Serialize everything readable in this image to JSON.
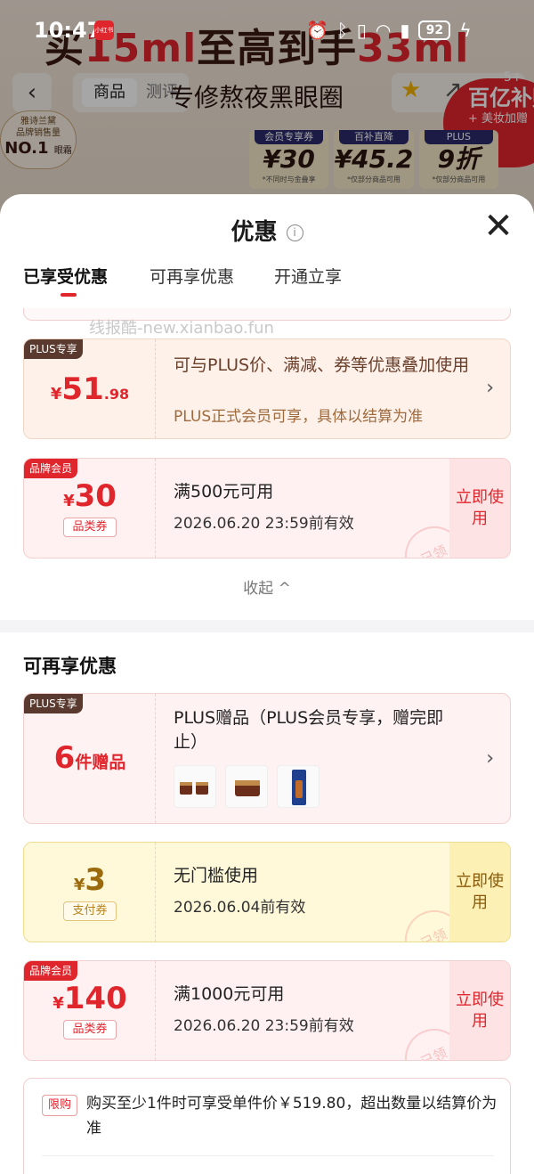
{
  "status_bar": {
    "time": "10:47",
    "app_badge": "小红书",
    "battery": "92"
  },
  "background": {
    "banner_prefix": "买",
    "banner_red1": "15ml",
    "banner_middle": "至高到手",
    "banner_red2": "33ml",
    "subtitle": "专修熬夜黑眼圈",
    "tab_product": "商品",
    "tab_review": "测评",
    "subsidy_badge": "5+",
    "subsidy_main": "百亿补贴",
    "subsidy_sub": "+ 美妆加赠",
    "no1_line1": "雅诗兰黛",
    "no1_line2": "品牌销售量",
    "no1_big": "NO.1",
    "no1_line3": "眼霜",
    "coupons": [
      {
        "tag": "会员专享券",
        "value": "¥30",
        "note": "*不同时与金叠享"
      },
      {
        "tag": "百补直降",
        "value": "¥45.2",
        "note": "*仅部分商品可用"
      },
      {
        "tag": "PLUS",
        "value": "9折",
        "note": "*仅部分商品可用"
      }
    ]
  },
  "sheet": {
    "title": "优惠",
    "close": "✕",
    "tabs": [
      "已享受优惠",
      "可再享优惠",
      "开通立享"
    ],
    "watermark": "线报酷-new.xianbao.fun",
    "plus_card": {
      "tag": "PLUS专享",
      "currency": "¥",
      "amount_int": "51",
      "amount_dec": ".98",
      "line1": "可与PLUS价、满减、券等优惠叠加使用",
      "line2": "PLUS正式会员可享，具体以结算为准"
    },
    "brand_card_1": {
      "tag": "品牌会员",
      "currency": "¥",
      "amount": "30",
      "type": "品类券",
      "line1": "满500元可用",
      "line2": "2026.06.20 23:59前有效",
      "button": "立即使用",
      "stamp": "已领"
    },
    "collapse": "收起 ^",
    "section_title": "可再享优惠",
    "gift_card": {
      "tag": "PLUS专享",
      "count": "6",
      "count_suffix": "件赠品",
      "line1": "PLUS赠品（PLUS会员专享，赠完即止）"
    },
    "pay_card": {
      "currency": "¥",
      "amount": "3",
      "type": "支付券",
      "line1": "无门槛使用",
      "line2": "2026.06.04前有效",
      "button": "立即使用",
      "stamp": "已领"
    },
    "brand_card_2": {
      "tag": "品牌会员",
      "currency": "¥",
      "amount": "140",
      "type": "品类券",
      "line1": "满1000元可用",
      "line2": "2026.06.20 23:59前有效",
      "button": "立即使用",
      "stamp": "已领"
    },
    "limit": {
      "tag": "限购",
      "text": "购买至少1件时可享受单件价￥519.80，超出数量以结算价为准"
    }
  },
  "colors": {
    "accent": "#e0262d",
    "plus_brown": "#5a3a2e",
    "pay_yellow": "#fff6cf"
  }
}
